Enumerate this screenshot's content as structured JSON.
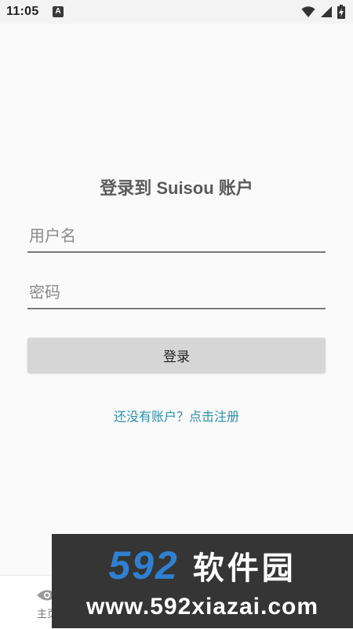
{
  "status_bar": {
    "time": "11:05",
    "notification_letter": "A",
    "icons": [
      "wifi-icon",
      "signal-icon",
      "battery-charging-icon"
    ]
  },
  "login": {
    "title": "登录到 Suisou 账户",
    "username_placeholder": "用户名",
    "password_placeholder": "密码",
    "username_value": "",
    "password_value": "",
    "login_button": "登录",
    "register_link": "还没有账户？点击注册"
  },
  "bottom_nav": {
    "items": [
      {
        "label": "主页",
        "icon": "eye-icon"
      }
    ]
  },
  "watermark": {
    "number": "592",
    "brand": "软件园",
    "url": "www.592xiazai.com"
  },
  "colors": {
    "background": "#fafafa",
    "title_text": "#5b5b5b",
    "button_bg": "#d6d6d6",
    "link": "#2b8fa8",
    "watermark_bg": "#353535",
    "watermark_number": "#2f80d0"
  }
}
